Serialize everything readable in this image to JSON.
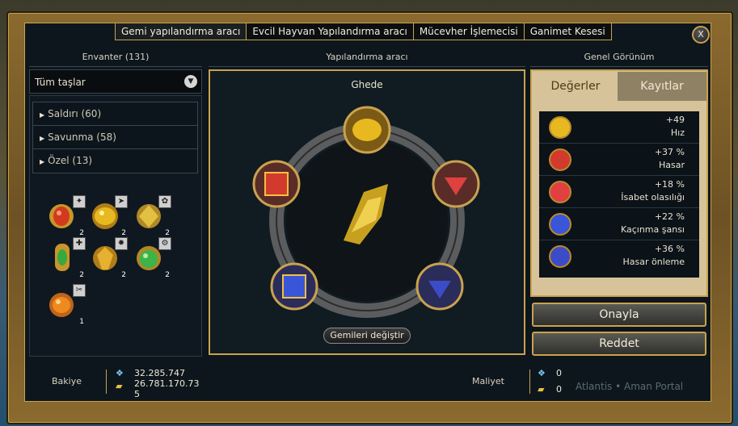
{
  "tabs": [
    "Gemi yapılandırma aracı",
    "Evcil Hayvan Yapılandırma aracı",
    "Mücevher İşlemecisi",
    "Ganimet Kesesi"
  ],
  "close_label": "X",
  "inventory": {
    "header": "Envanter (131)",
    "filter": "Tüm taşlar",
    "categories": [
      "Saldırı (60)",
      "Savunma (58)",
      "Özel (13)"
    ],
    "items": [
      {
        "count": "2",
        "color": "#d23a1e",
        "icon": "ruby-gem-icon"
      },
      {
        "count": "2",
        "color": "#e8b820",
        "icon": "gold-gem-icon"
      },
      {
        "count": "2",
        "color": "#e2c040",
        "icon": "gold-gem-icon"
      },
      {
        "count": "2",
        "color": "#38a840",
        "icon": "emerald-gem-icon"
      },
      {
        "count": "2",
        "color": "#e6b030",
        "icon": "topaz-gem-icon"
      },
      {
        "count": "2",
        "color": "#3cb44a",
        "icon": "emerald-gem-icon"
      },
      {
        "count": "1",
        "color": "#ee8a20",
        "icon": "amber-gem-icon"
      }
    ]
  },
  "configurator": {
    "header": "Yapılandırma aracı",
    "ship_name": "Ghede",
    "change_button": "Gemileri değiştir"
  },
  "overview": {
    "header": "Genel Görünüm",
    "tab_values": "Değerler",
    "tab_records": "Kayıtlar",
    "stats": [
      {
        "value": "+49",
        "name": "Hız",
        "color": "#e8b820"
      },
      {
        "value": "+37 %",
        "name": "Hasar",
        "color": "#d23a2e"
      },
      {
        "value": "+18 %",
        "name": "İsabet olasılığı",
        "color": "#e04040"
      },
      {
        "value": "+22 %",
        "name": "Kaçınma şansı",
        "color": "#3a56d8"
      },
      {
        "value": "+36 %",
        "name": "Hasar önleme",
        "color": "#3c4cc8"
      }
    ],
    "confirm": "Onayla",
    "reject": "Reddet"
  },
  "footer": {
    "balance_label": "Bakiye",
    "balance_1": "32.285.747",
    "balance_2": "26.781.170.73",
    "balance_3": "5",
    "cost_label": "Maliyet",
    "cost_1": "0",
    "cost_2": "0",
    "bg_text": "Atlantis • Aman Portal"
  },
  "colors": {
    "gold": "#c9a24e",
    "panel": "#0d161d"
  }
}
